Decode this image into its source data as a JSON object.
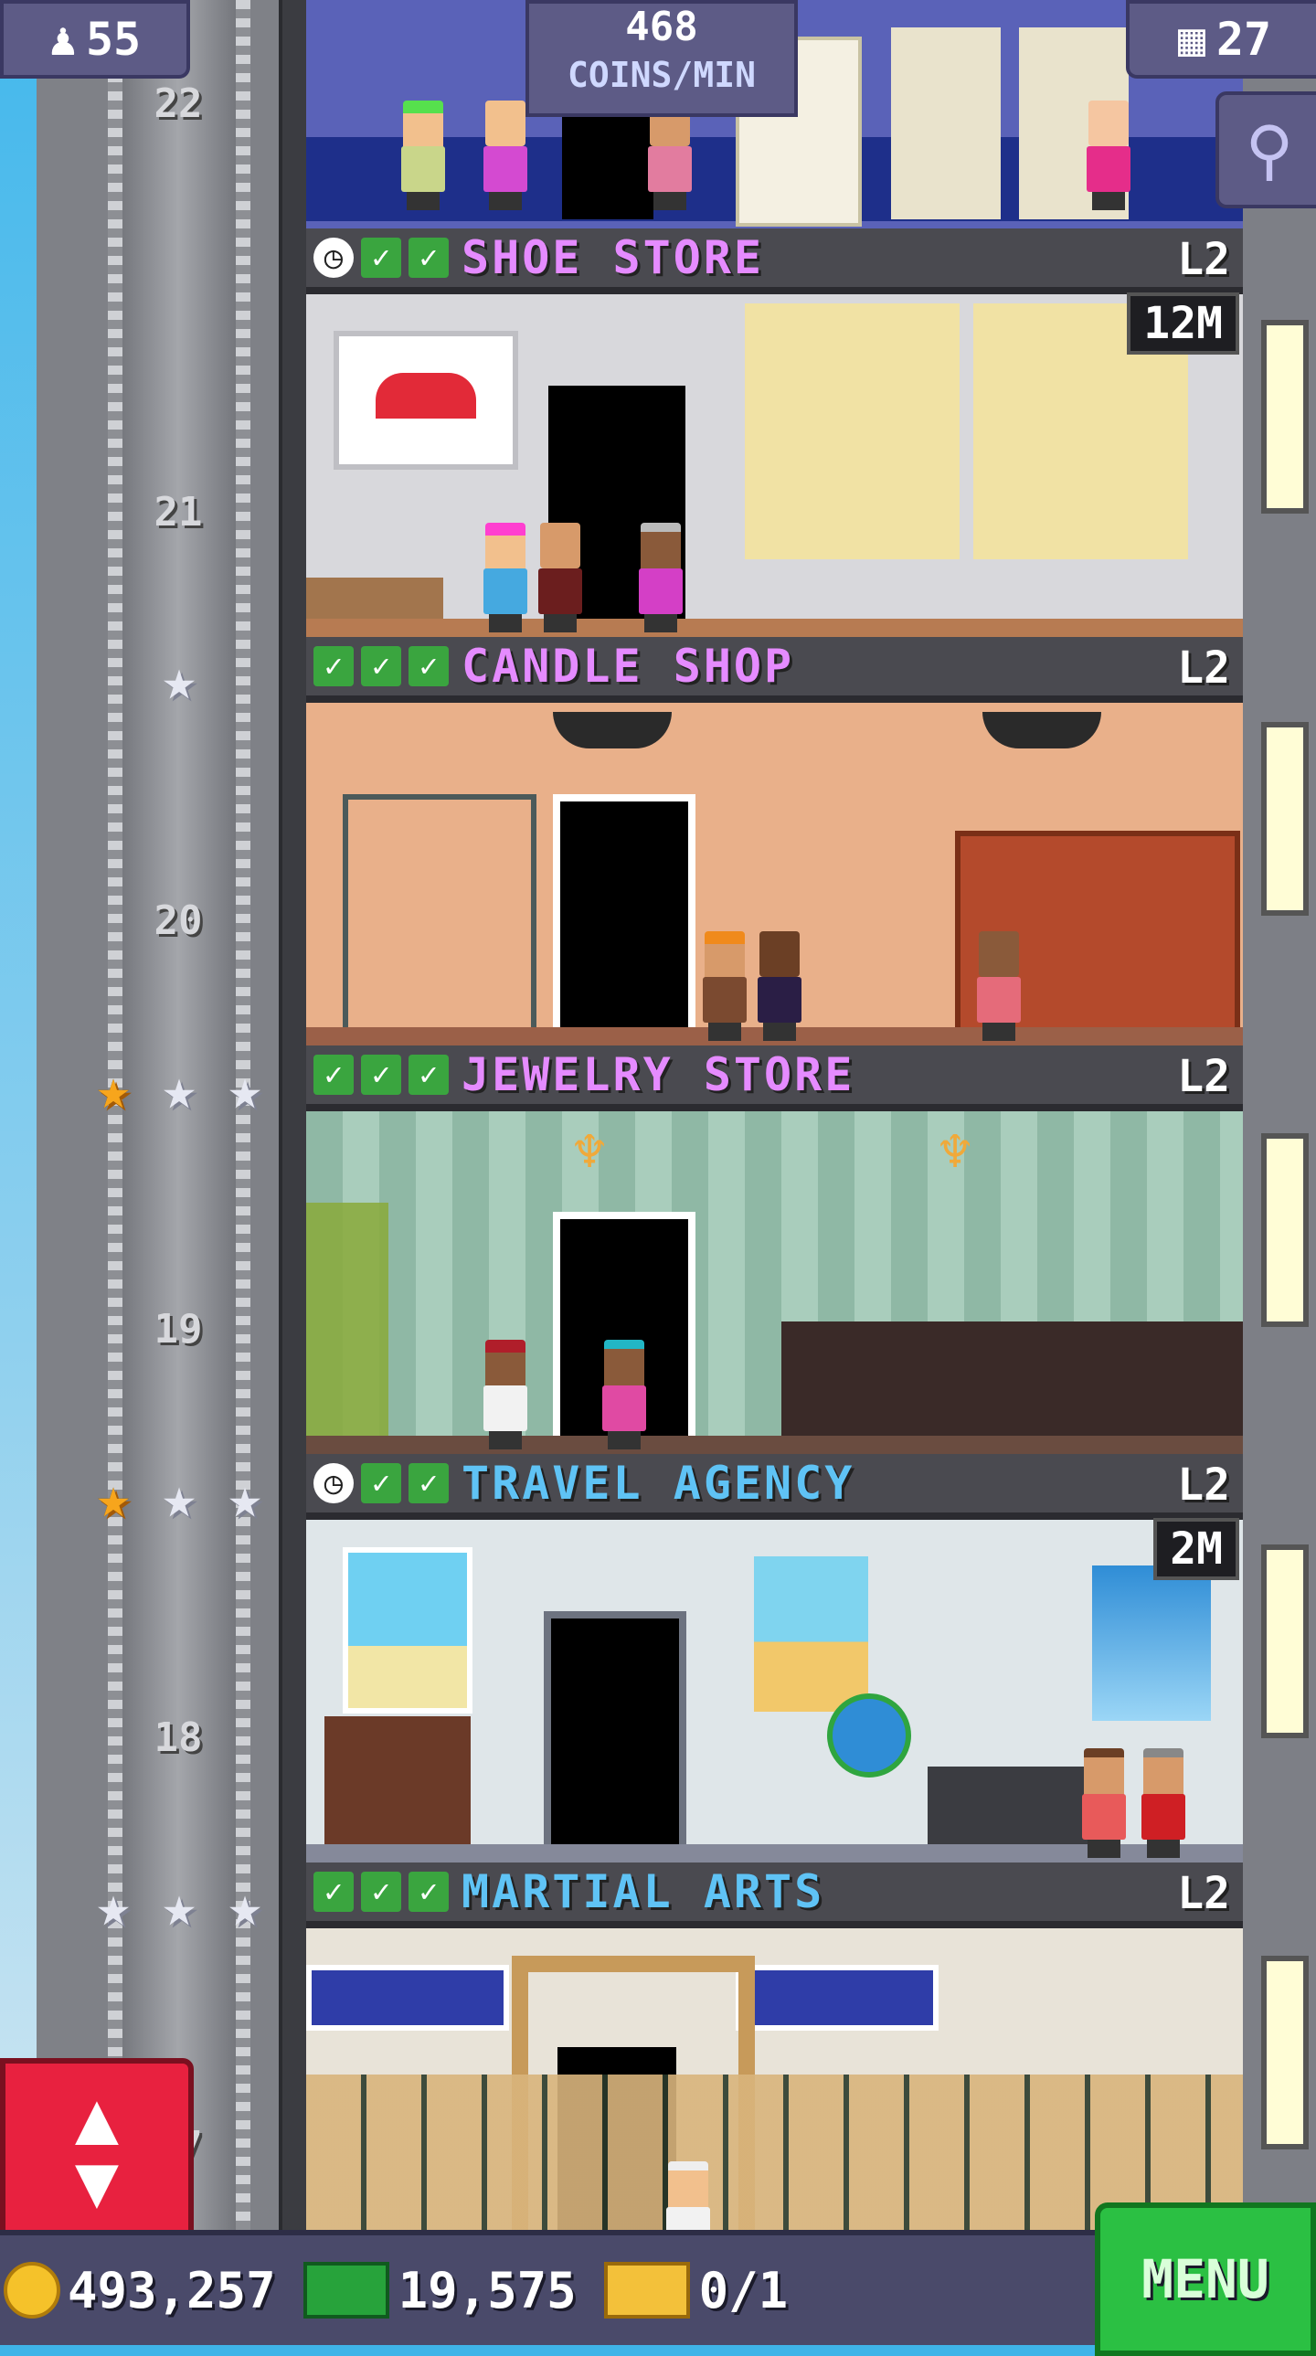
{
  "hud": {
    "population": "55",
    "coins_per_min_value": "468",
    "coins_per_min_label": "COINS/MIN",
    "floors_count": "27"
  },
  "floors": [
    {
      "number": "22",
      "name": "SHOE STORE",
      "name_color": "#e58bff",
      "level": "L2",
      "timer": "12M",
      "has_clock": true,
      "checks": 2,
      "stars": "none"
    },
    {
      "number": "21",
      "name": "CANDLE SHOP",
      "name_color": "#e58bff",
      "level": "L2",
      "timer": "",
      "has_clock": false,
      "checks": 3,
      "stars": "silver-1"
    },
    {
      "number": "20",
      "name": "JEWELRY STORE",
      "name_color": "#e58bff",
      "level": "L2",
      "timer": "",
      "has_clock": false,
      "checks": 3,
      "stars": "gold-1-silver-2"
    },
    {
      "number": "19",
      "name": "TRAVEL AGENCY",
      "name_color": "#5fc3f5",
      "level": "L2",
      "timer": "2M",
      "has_clock": true,
      "checks": 2,
      "stars": "gold-1-silver-2"
    },
    {
      "number": "18",
      "name": "MARTIAL ARTS",
      "name_color": "#5fc3f5",
      "level": "L2",
      "timer": "",
      "has_clock": false,
      "checks": 3,
      "stars": "silver-3"
    },
    {
      "number": "17"
    }
  ],
  "footer": {
    "coins": "493,257",
    "bux": "19,575",
    "tickets": "0/1",
    "menu_label": "MENU"
  },
  "icons": {
    "person": "person-icon",
    "floors": "building-icon",
    "zoom": "magnifier-icon",
    "elevator": "up-down-arrows-icon",
    "coin": "coin-icon",
    "bux": "bux-icon",
    "ticket": "golden-ticket-icon",
    "clock": "clock-icon",
    "check": "check-icon",
    "star": "star-icon"
  }
}
